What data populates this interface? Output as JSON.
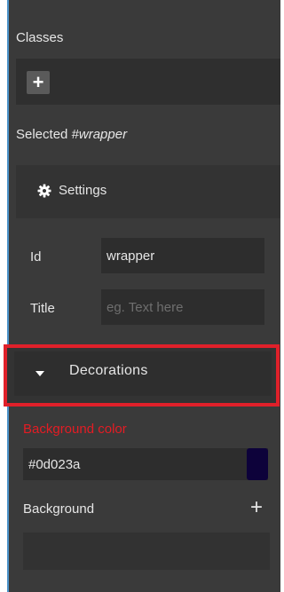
{
  "classes": {
    "heading": "Classes",
    "add_button_label": "+"
  },
  "selected": {
    "prefix": "Selected ",
    "target": "#wrapper"
  },
  "settings": {
    "title": "Settings",
    "icon": "gear-icon",
    "id_label": "Id",
    "id_value": "wrapper",
    "title_label": "Title",
    "title_placeholder": "eg. Text here"
  },
  "decorations": {
    "title": "Decorations",
    "icon": "caret-down-icon"
  },
  "background_color": {
    "label": "Background color",
    "value": "#0d023a",
    "swatch_color": "#0d023a"
  },
  "background": {
    "label": "Background",
    "add_label": "+"
  },
  "colors": {
    "panel_bg": "#3a3a3a",
    "highlight_border": "#e0202a",
    "label_red": "#e41c24",
    "accent_rule": "#4b92c8"
  }
}
